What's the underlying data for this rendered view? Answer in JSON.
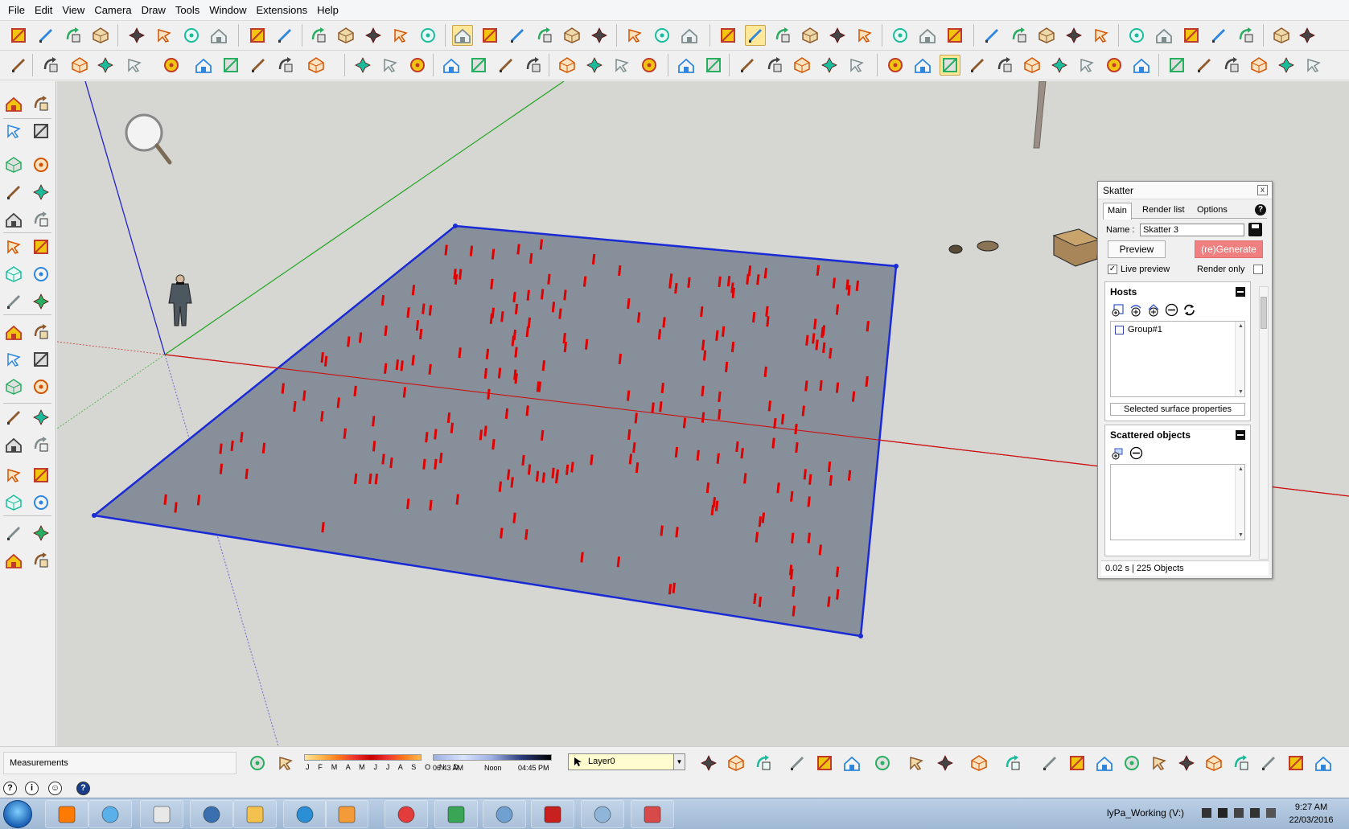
{
  "menu": [
    "File",
    "Edit",
    "View",
    "Camera",
    "Draw",
    "Tools",
    "Window",
    "Extensions",
    "Help"
  ],
  "skatter": {
    "title": "Skatter",
    "close_label": "x",
    "tabs": [
      "Main",
      "Render list",
      "Options"
    ],
    "active_tab": "Main",
    "help_label": "?",
    "name_label": "Name :",
    "name_value": "Skatter 3",
    "preview_label": "Preview",
    "generate_label": "(re)Generate",
    "live_preview_label": "Live preview",
    "live_preview_checked": true,
    "render_only_label": "Render only",
    "render_only_checked": false,
    "hosts_title": "Hosts",
    "hosts_items": [
      "Group#1"
    ],
    "selected_surface_label": "Selected surface properties",
    "scattered_title": "Scattered objects",
    "status": "0.02 s | 225 Objects",
    "accent_color": "#f08080"
  },
  "bottom": {
    "measurements_label": "Measurements",
    "months": "J F M A M J J A S O N D",
    "time_start": "06:43 AM",
    "time_noon": "Noon",
    "time_end": "04:45 PM",
    "layer": "Layer0"
  },
  "taskbar": {
    "tray_text": "lyPa_Working (V:)",
    "clock_time": "9:27 AM",
    "clock_date": "22/03/2016"
  },
  "scene": {
    "plane_color": "#87909a",
    "edge_color": "#1a2bd6",
    "marker_color": "#e00000",
    "marker_count": 225
  }
}
